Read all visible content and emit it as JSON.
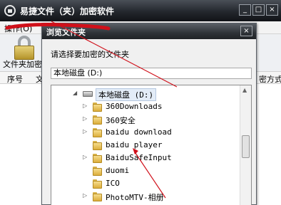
{
  "app": {
    "title": "易捷文件（夹）加密软件",
    "window_buttons": {
      "minimize": "_",
      "maximize": "□",
      "close": "×"
    },
    "menu_label": "操作(O)",
    "toolbar_label": "文件夹加密",
    "columns": {
      "no": "序号",
      "cut": "文",
      "method": "密方式"
    }
  },
  "dialog": {
    "title": "浏览文件夹",
    "close": "×",
    "prompt": "请选择要加密的文件夹",
    "path_value": "本地磁盘 (D:)",
    "tree": {
      "drive": {
        "label": "本地磁盘 (D:)",
        "expander": "◢"
      },
      "folders": [
        {
          "label": "360Downloads",
          "expander": "▷"
        },
        {
          "label": "360安全",
          "expander": "▷"
        },
        {
          "label": "baidu download",
          "expander": "▷"
        },
        {
          "label": "baidu player",
          "expander": ""
        },
        {
          "label": "BaiduSafeInput",
          "expander": "▷"
        },
        {
          "label": "duomi",
          "expander": ""
        },
        {
          "label": "ICO",
          "expander": ""
        },
        {
          "label": "PhotoMTV-相册",
          "expander": "▷"
        }
      ]
    },
    "scroll_up": "▲"
  },
  "annotation_color": "#d0101a"
}
